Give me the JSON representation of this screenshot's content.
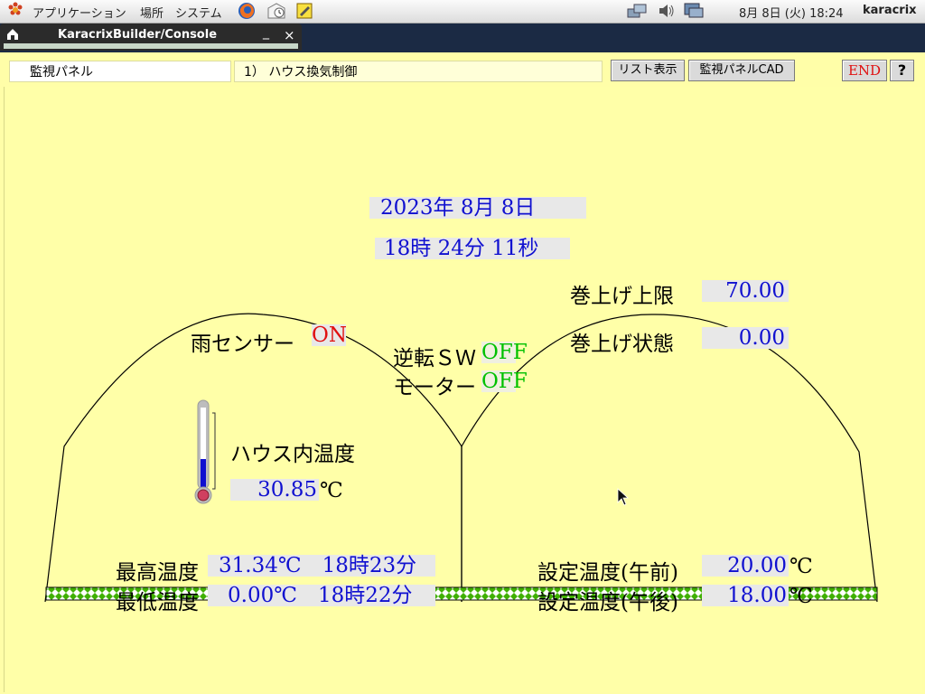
{
  "topbar": {
    "apps_label": "アプリケーション",
    "places_label": "場所",
    "system_label": "システム",
    "clock": "8月 8日 (火) 18:24",
    "user": "karacrix"
  },
  "console": {
    "title": "KaracrixBuilder/Console",
    "minimize": "_",
    "close": "×"
  },
  "toolbar": {
    "panel_name": "監視パネル",
    "page_name": "1） ハウス換気制御",
    "list_button": "リスト表示",
    "cad_button": "監視パネルCAD",
    "end_button": "END",
    "help_button": "?"
  },
  "monitor": {
    "date": "2023年 8月 8日",
    "time": "18時 24分 11秒",
    "rollup_limit_label": "巻上げ上限",
    "rollup_limit_value": "70.00",
    "rollup_state_label": "巻上げ状態",
    "rollup_state_value": "0.00",
    "rain_label": "雨センサー",
    "rain_value": "ON",
    "reverse_label": "逆転ＳＷ",
    "reverse_value": "OFF",
    "motor_label": "モーター",
    "motor_value": "OFF",
    "house_temp_label": "ハウス内温度",
    "house_temp_value": "30.85",
    "temp_unit": "℃",
    "max_label": "最高温度",
    "max_value": "31.34℃　18時23分",
    "min_label": "最低温度",
    "min_value": "0.00℃　18時22分",
    "set_am_label": "設定温度(午前)",
    "set_am_value": "20.00",
    "set_pm_label": "設定温度(午後)",
    "set_pm_value": "18.00"
  },
  "colors": {
    "panel_bg": "#ffffa8",
    "value_blue": "#1010d0",
    "on_red": "#e01010",
    "off_green": "#00c000",
    "thermo_fill": "#1010d0"
  }
}
